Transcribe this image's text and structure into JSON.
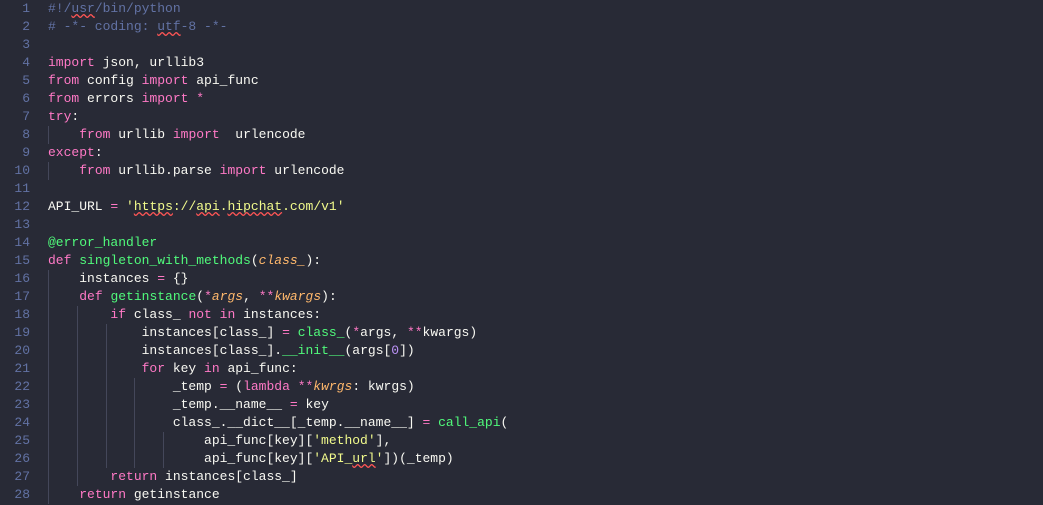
{
  "lines": [
    {
      "n": 1,
      "i": 0,
      "t": [
        [
          "comment",
          "#!/"
        ],
        [
          "comment squiggle",
          "usr"
        ],
        [
          "comment",
          "/bin/python"
        ]
      ]
    },
    {
      "n": 2,
      "i": 0,
      "t": [
        [
          "comment",
          "# -*- coding: "
        ],
        [
          "comment squiggle",
          "utf"
        ],
        [
          "comment",
          "-8 -*-"
        ]
      ]
    },
    {
      "n": 3,
      "i": 0,
      "t": []
    },
    {
      "n": 4,
      "i": 0,
      "t": [
        [
          "keyword",
          "import"
        ],
        [
          "plain",
          " json, urllib3"
        ]
      ]
    },
    {
      "n": 5,
      "i": 0,
      "t": [
        [
          "keyword",
          "from"
        ],
        [
          "plain",
          " config "
        ],
        [
          "keyword",
          "import"
        ],
        [
          "plain",
          " api_func"
        ]
      ]
    },
    {
      "n": 6,
      "i": 0,
      "t": [
        [
          "keyword",
          "from"
        ],
        [
          "plain",
          " errors "
        ],
        [
          "keyword",
          "import"
        ],
        [
          "plain",
          " "
        ],
        [
          "op",
          "*"
        ]
      ]
    },
    {
      "n": 7,
      "i": 0,
      "t": [
        [
          "keyword",
          "try"
        ],
        [
          "plain",
          ":"
        ]
      ]
    },
    {
      "n": 8,
      "i": 1,
      "t": [
        [
          "keyword",
          "from"
        ],
        [
          "plain",
          " urllib "
        ],
        [
          "keyword",
          "import"
        ],
        [
          "plain",
          "  urlencode"
        ]
      ]
    },
    {
      "n": 9,
      "i": 0,
      "t": [
        [
          "keyword",
          "except"
        ],
        [
          "plain",
          ":"
        ]
      ]
    },
    {
      "n": 10,
      "i": 1,
      "t": [
        [
          "keyword",
          "from"
        ],
        [
          "plain",
          " urllib.parse "
        ],
        [
          "keyword",
          "import"
        ],
        [
          "plain",
          " urlencode"
        ]
      ]
    },
    {
      "n": 11,
      "i": 0,
      "t": []
    },
    {
      "n": 12,
      "i": 0,
      "t": [
        [
          "plain",
          "API_URL "
        ],
        [
          "op",
          "="
        ],
        [
          "plain",
          " "
        ],
        [
          "string",
          "'"
        ],
        [
          "string squiggle",
          "https"
        ],
        [
          "string",
          "://"
        ],
        [
          "string squiggle",
          "api"
        ],
        [
          "string",
          "."
        ],
        [
          "string squiggle",
          "hipchat"
        ],
        [
          "string",
          ".com/v1'"
        ]
      ]
    },
    {
      "n": 13,
      "i": 0,
      "t": []
    },
    {
      "n": 14,
      "i": 0,
      "t": [
        [
          "decorator",
          "@error_handler"
        ]
      ]
    },
    {
      "n": 15,
      "i": 0,
      "t": [
        [
          "keyword",
          "def"
        ],
        [
          "plain",
          " "
        ],
        [
          "func",
          "singleton_with_methods"
        ],
        [
          "plain",
          "("
        ],
        [
          "param",
          "class_"
        ],
        [
          "plain",
          "):"
        ]
      ]
    },
    {
      "n": 16,
      "i": 1,
      "t": [
        [
          "plain",
          "instances "
        ],
        [
          "op",
          "="
        ],
        [
          "plain",
          " {}"
        ]
      ]
    },
    {
      "n": 17,
      "i": 1,
      "t": [
        [
          "keyword",
          "def"
        ],
        [
          "plain",
          " "
        ],
        [
          "func",
          "getinstance"
        ],
        [
          "plain",
          "("
        ],
        [
          "op",
          "*"
        ],
        [
          "param",
          "args"
        ],
        [
          "plain",
          ", "
        ],
        [
          "op",
          "**"
        ],
        [
          "param",
          "kwargs"
        ],
        [
          "plain",
          "):"
        ]
      ]
    },
    {
      "n": 18,
      "i": 2,
      "t": [
        [
          "keyword",
          "if"
        ],
        [
          "plain",
          " class_ "
        ],
        [
          "keyword",
          "not"
        ],
        [
          "plain",
          " "
        ],
        [
          "keyword",
          "in"
        ],
        [
          "plain",
          " instances:"
        ]
      ]
    },
    {
      "n": 19,
      "i": 3,
      "t": [
        [
          "plain",
          "instances[class_] "
        ],
        [
          "op",
          "="
        ],
        [
          "plain",
          " "
        ],
        [
          "funccall",
          "class_"
        ],
        [
          "plain",
          "("
        ],
        [
          "op",
          "*"
        ],
        [
          "plain",
          "args, "
        ],
        [
          "op",
          "**"
        ],
        [
          "plain",
          "kwargs)"
        ]
      ]
    },
    {
      "n": 20,
      "i": 3,
      "t": [
        [
          "plain",
          "instances[class_]."
        ],
        [
          "funccall",
          "__init__"
        ],
        [
          "plain",
          "(args["
        ],
        [
          "number",
          "0"
        ],
        [
          "plain",
          "])"
        ]
      ]
    },
    {
      "n": 21,
      "i": 3,
      "t": [
        [
          "keyword",
          "for"
        ],
        [
          "plain",
          " key "
        ],
        [
          "keyword",
          "in"
        ],
        [
          "plain",
          " api_func:"
        ]
      ]
    },
    {
      "n": 22,
      "i": 4,
      "t": [
        [
          "plain",
          "_temp "
        ],
        [
          "op",
          "="
        ],
        [
          "plain",
          " ("
        ],
        [
          "keyword",
          "lambda"
        ],
        [
          "plain",
          " "
        ],
        [
          "op",
          "**"
        ],
        [
          "param",
          "kwrgs"
        ],
        [
          "plain",
          ": kwrgs)"
        ]
      ]
    },
    {
      "n": 23,
      "i": 4,
      "t": [
        [
          "plain",
          "_temp.__name__ "
        ],
        [
          "op",
          "="
        ],
        [
          "plain",
          " key"
        ]
      ]
    },
    {
      "n": 24,
      "i": 4,
      "t": [
        [
          "plain",
          "class_.__dict__[_temp.__name__] "
        ],
        [
          "op",
          "="
        ],
        [
          "plain",
          " "
        ],
        [
          "funccall",
          "call_api"
        ],
        [
          "plain",
          "("
        ]
      ]
    },
    {
      "n": 25,
      "i": 5,
      "t": [
        [
          "plain",
          "api_func[key]["
        ],
        [
          "string",
          "'method'"
        ],
        [
          "plain",
          "],"
        ]
      ]
    },
    {
      "n": 26,
      "i": 5,
      "t": [
        [
          "plain",
          "api_func[key]["
        ],
        [
          "string",
          "'API_"
        ],
        [
          "string squiggle",
          "url"
        ],
        [
          "string",
          "'"
        ],
        [
          "plain",
          "])(_temp)"
        ]
      ]
    },
    {
      "n": 27,
      "i": 2,
      "t": [
        [
          "keyword",
          "return"
        ],
        [
          "plain",
          " instances[class_]"
        ]
      ]
    },
    {
      "n": 28,
      "i": 1,
      "t": [
        [
          "keyword",
          "return"
        ],
        [
          "plain",
          " getinstance"
        ]
      ]
    }
  ],
  "indentWidth": 4,
  "charWidth": 7.2
}
